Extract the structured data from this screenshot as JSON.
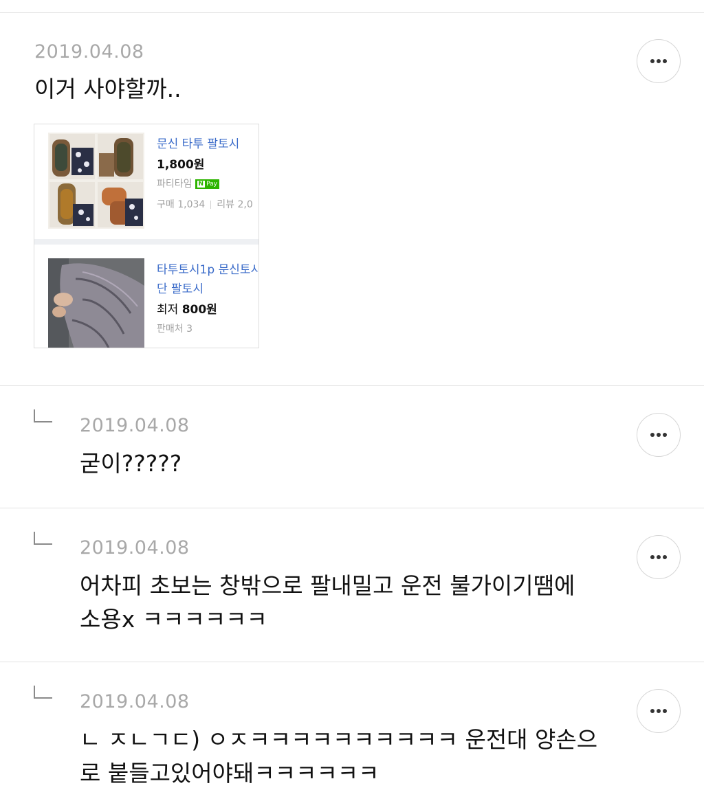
{
  "posts": [
    {
      "date": "2019.04.08",
      "lines": [
        "이거 사야할까.."
      ],
      "reply": false
    },
    {
      "date": "2019.04.08",
      "lines": [
        "굳이?????"
      ],
      "reply": true
    },
    {
      "date": "2019.04.08",
      "lines": [
        "어차피 초보는 창밖으로 팔내밀고 운전 불가이기땜에",
        "소용x ㅋㅋㅋㅋㅋㅋ"
      ],
      "reply": true
    },
    {
      "date": "2019.04.08",
      "lines": [
        "ㄴ ㅈㄴㄱㄷ) ㅇㅈㅋㅋㅋㅋㅋㅋㅋㅋㅋㅋ 운전대 양손으",
        "로 붙들고있어야돼ㅋㅋㅋㅋㅋㅋ"
      ],
      "reply": true
    }
  ],
  "shopping_card": {
    "items": [
      {
        "title": "문신 타투 팔토시",
        "price": "1,800원",
        "seller": "파티타임",
        "pay_badge_n": "N",
        "pay_badge_label": "Pay",
        "purchases": "구매 1,034",
        "reviews": "리뷰 2,0"
      },
      {
        "title_line1": "타투토시1p 문신토시",
        "title_line2": "단 팔토시",
        "price_prefix": "최저",
        "price": "800원",
        "sellers": "판매처 3"
      }
    ]
  },
  "icons": {
    "more": "more-horizontal-icon",
    "reply": "reply-arrow-icon"
  },
  "colors": {
    "date": "#a8a8a8",
    "text": "#111111",
    "link": "#3a6bc9",
    "npay": "#2db400",
    "divider": "#e2e2e2"
  }
}
